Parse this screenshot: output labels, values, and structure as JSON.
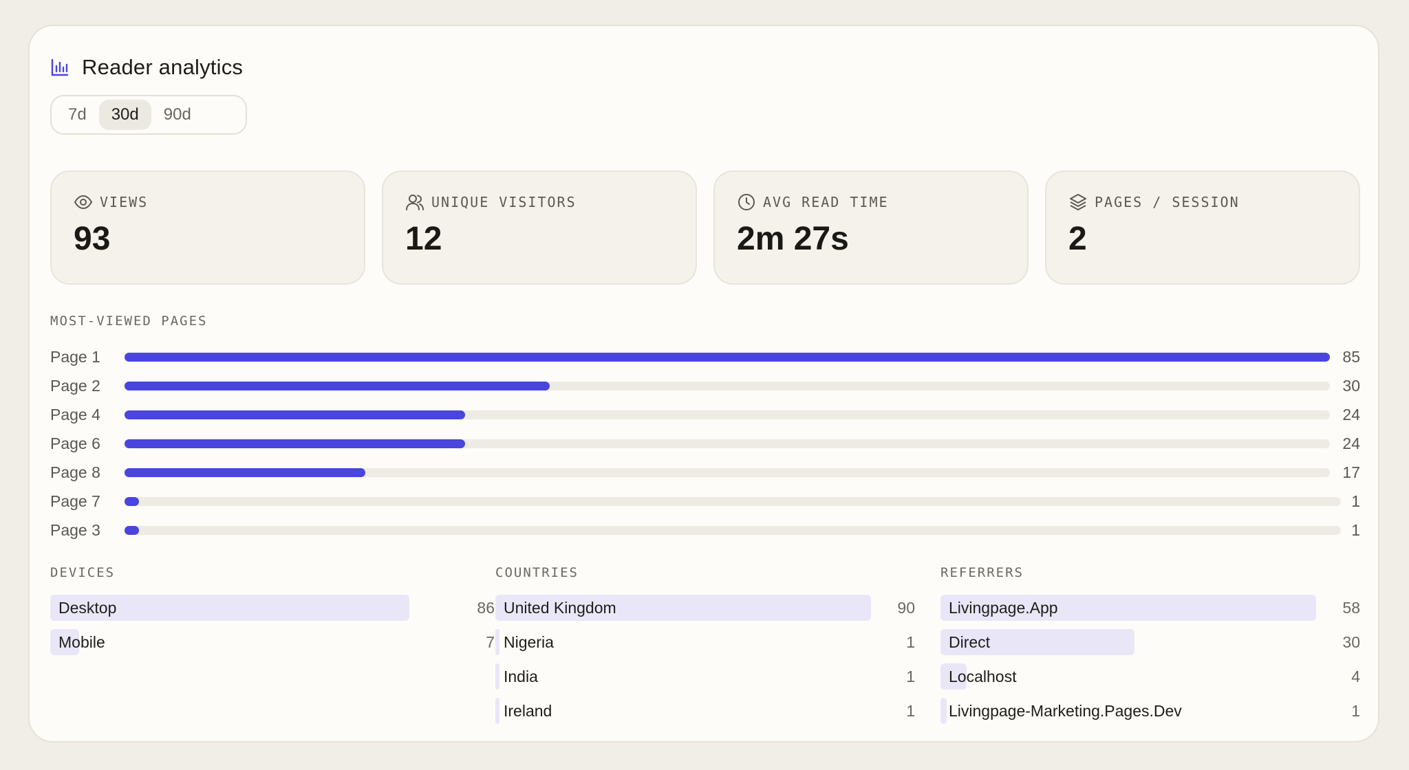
{
  "header": {
    "title": "Reader analytics",
    "icon": "bar-chart-icon"
  },
  "range": {
    "options": [
      "7d",
      "30d",
      "90d"
    ],
    "selected": "30d"
  },
  "stats": [
    {
      "label": "VIEWS",
      "value": "93",
      "icon": "eye-icon"
    },
    {
      "label": "UNIQUE VISITORS",
      "value": "12",
      "icon": "users-icon"
    },
    {
      "label": "AVG READ TIME",
      "value": "2m 27s",
      "icon": "clock-icon"
    },
    {
      "label": "PAGES / SESSION",
      "value": "2",
      "icon": "layers-icon"
    }
  ],
  "most_viewed": {
    "label": "MOST-VIEWED PAGES",
    "items": [
      {
        "name": "Page 1",
        "count": 85
      },
      {
        "name": "Page 2",
        "count": 30
      },
      {
        "name": "Page 4",
        "count": 24
      },
      {
        "name": "Page 6",
        "count": 24
      },
      {
        "name": "Page 8",
        "count": 17
      },
      {
        "name": "Page 7",
        "count": 1
      },
      {
        "name": "Page 3",
        "count": 1
      }
    ]
  },
  "devices": {
    "label": "DEVICES",
    "items": [
      {
        "name": "Desktop",
        "count": 86
      },
      {
        "name": "Mobile",
        "count": 7
      }
    ]
  },
  "countries": {
    "label": "COUNTRIES",
    "items": [
      {
        "name": "United Kingdom",
        "count": 90
      },
      {
        "name": "Nigeria",
        "count": 1
      },
      {
        "name": "India",
        "count": 1
      },
      {
        "name": "Ireland",
        "count": 1
      }
    ]
  },
  "referrers": {
    "label": "REFERRERS",
    "items": [
      {
        "name": "Livingpage.App",
        "count": 58
      },
      {
        "name": "Direct",
        "count": 30
      },
      {
        "name": "Localhost",
        "count": 4
      },
      {
        "name": "Livingpage-Marketing.Pages.Dev",
        "count": 1
      }
    ]
  },
  "colors": {
    "accent": "#4a45dc",
    "accent_light": "#e9e7f7",
    "track": "#eeebe4"
  }
}
